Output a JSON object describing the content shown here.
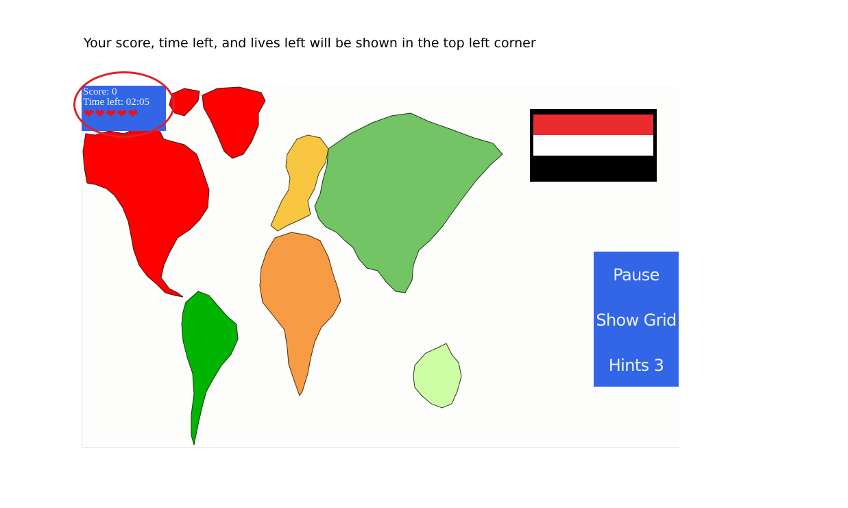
{
  "instruction": "Your score, time left, and lives left will be shown in the top left corner",
  "hud": {
    "score_text": "Score: 0",
    "time_text": "Time left: 02:05",
    "lives": 5,
    "heart_glyph": "❤"
  },
  "flag": {
    "colors": [
      "#ec2b2f",
      "#ffffff",
      "#000000"
    ]
  },
  "continents": [
    {
      "id": "north-america",
      "color": "#fe0000"
    },
    {
      "id": "south-america",
      "color": "#00b400"
    },
    {
      "id": "europe",
      "color": "#f9c641"
    },
    {
      "id": "africa",
      "color": "#f79c45"
    },
    {
      "id": "asia",
      "color": "#72c465"
    },
    {
      "id": "australia",
      "color": "#cdfea5"
    }
  ],
  "controls": {
    "pause_label": "Pause",
    "grid_label": "Show Grid",
    "hints_label": "Hints 3"
  },
  "colors": {
    "panel_blue": "#3366e6",
    "annotation_red": "#e0202a"
  }
}
